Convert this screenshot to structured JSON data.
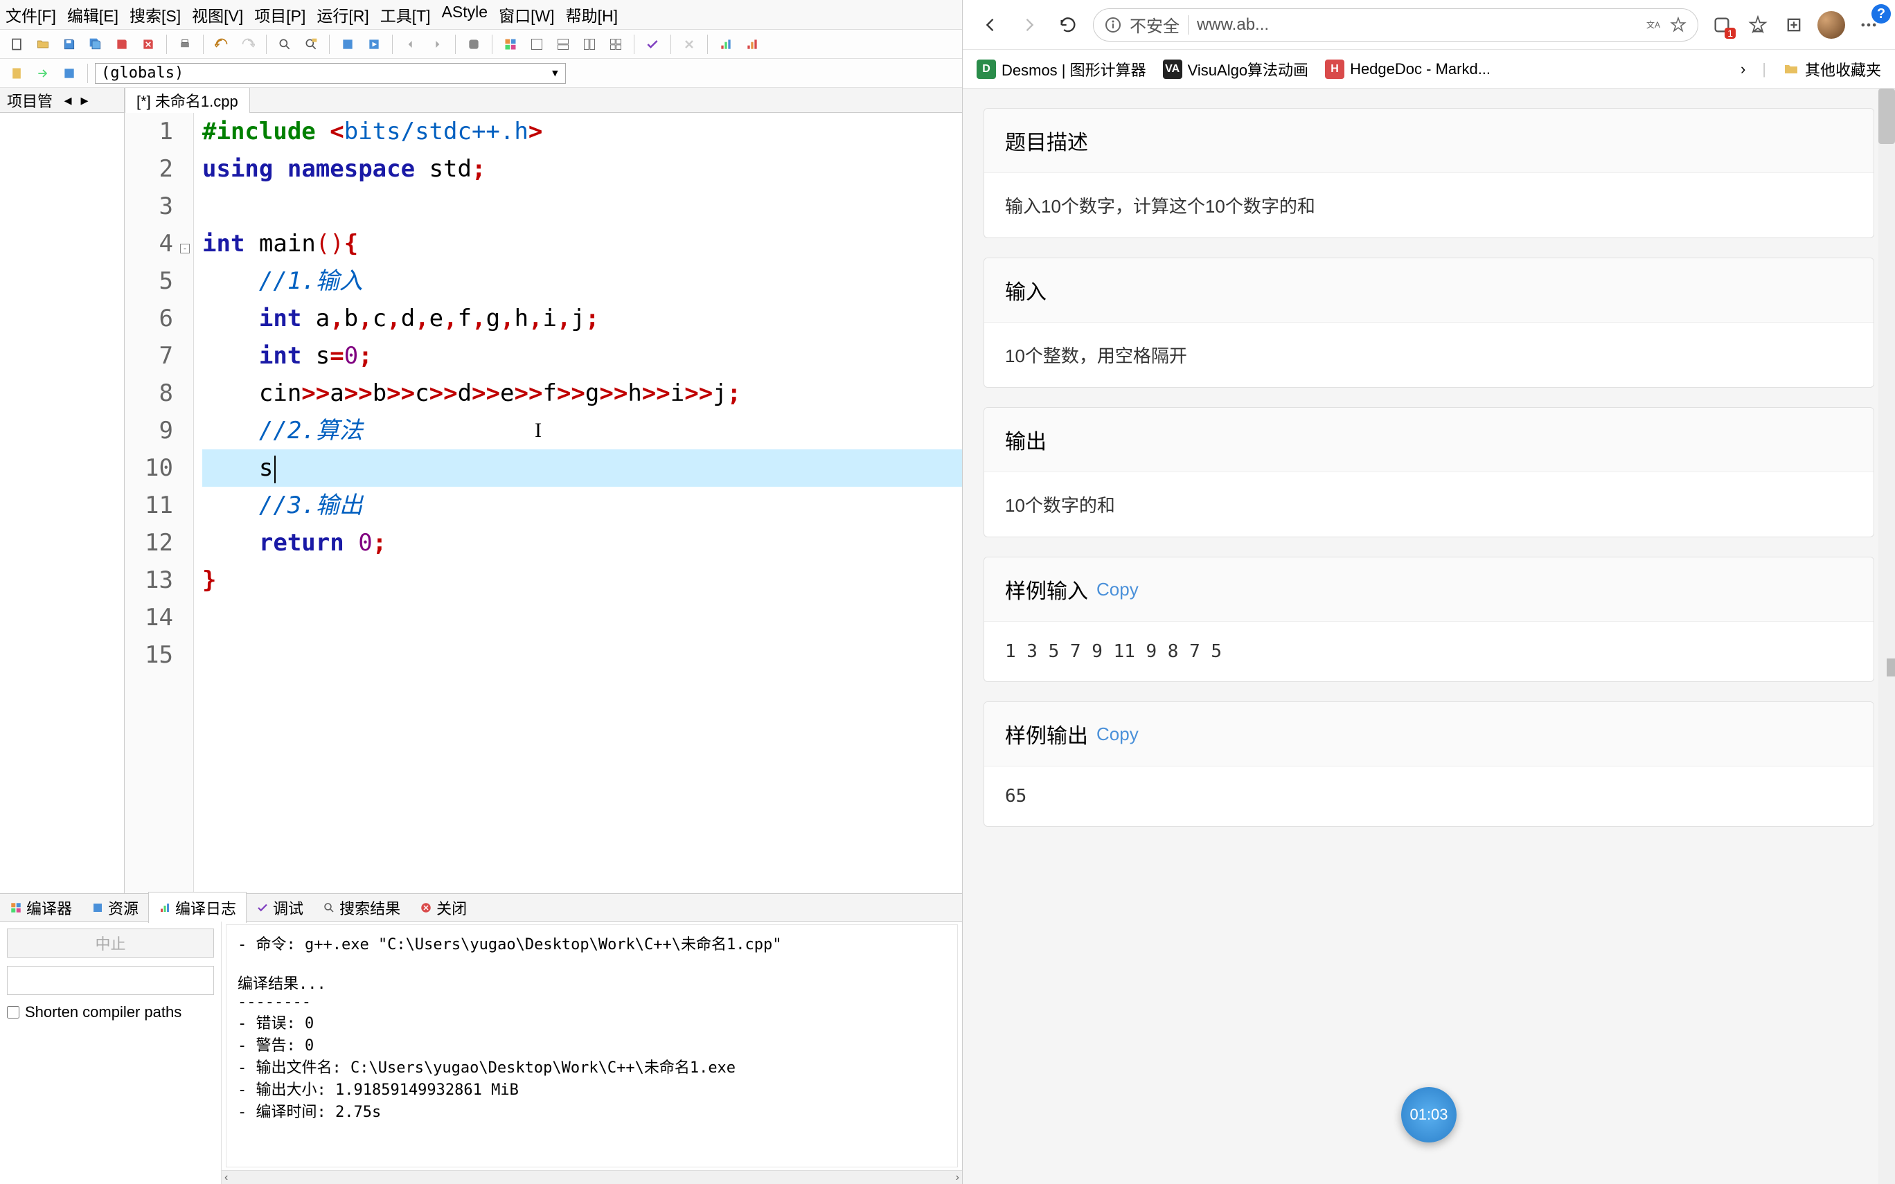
{
  "menubar": {
    "file": "文件[F]",
    "edit": "编辑[E]",
    "search": "搜索[S]",
    "view": "视图[V]",
    "project": "项目[P]",
    "run": "运行[R]",
    "tools": "工具[T]",
    "astyle": "AStyle",
    "window": "窗口[W]",
    "help": "帮助[H]"
  },
  "globals_selector": "(globals)",
  "sidebar": {
    "project_tab": "项目管"
  },
  "file_tab": "[*] 未命名1.cpp",
  "code": {
    "lines": [
      {
        "n": 1,
        "tokens": [
          [
            "preproc",
            "#include "
          ],
          [
            "op",
            "<"
          ],
          [
            "str",
            "bits/stdc++.h"
          ],
          [
            "op",
            ">"
          ]
        ]
      },
      {
        "n": 2,
        "tokens": [
          [
            "kw",
            "using"
          ],
          [
            "",
            " "
          ],
          [
            "kw",
            "namespace"
          ],
          [
            "",
            " "
          ],
          [
            "",
            "std"
          ],
          [
            "op",
            ";"
          ]
        ]
      },
      {
        "n": 3,
        "tokens": []
      },
      {
        "n": 4,
        "fold": true,
        "tokens": [
          [
            "kw",
            "int"
          ],
          [
            "",
            " "
          ],
          [
            "",
            "main"
          ],
          [
            "paren",
            "()"
          ],
          [
            "op",
            "{"
          ]
        ]
      },
      {
        "n": 5,
        "tokens": [
          [
            "",
            "    "
          ],
          [
            "comment",
            "//1.输入"
          ]
        ]
      },
      {
        "n": 6,
        "tokens": [
          [
            "",
            "    "
          ],
          [
            "kw",
            "int"
          ],
          [
            "",
            " a"
          ],
          [
            "op",
            ","
          ],
          [
            "",
            "b"
          ],
          [
            "op",
            ","
          ],
          [
            "",
            "c"
          ],
          [
            "op",
            ","
          ],
          [
            "",
            "d"
          ],
          [
            "op",
            ","
          ],
          [
            "",
            "e"
          ],
          [
            "op",
            ","
          ],
          [
            "",
            "f"
          ],
          [
            "op",
            ","
          ],
          [
            "",
            "g"
          ],
          [
            "op",
            ","
          ],
          [
            "",
            "h"
          ],
          [
            "op",
            ","
          ],
          [
            "",
            "i"
          ],
          [
            "op",
            ","
          ],
          [
            "",
            "j"
          ],
          [
            "op",
            ";"
          ]
        ]
      },
      {
        "n": 7,
        "tokens": [
          [
            "",
            "    "
          ],
          [
            "kw",
            "int"
          ],
          [
            "",
            " s"
          ],
          [
            "op",
            "="
          ],
          [
            "num",
            "0"
          ],
          [
            "op",
            ";"
          ]
        ]
      },
      {
        "n": 8,
        "tokens": [
          [
            "",
            "    cin"
          ],
          [
            "op",
            ">>"
          ],
          [
            "",
            "a"
          ],
          [
            "op",
            ">>"
          ],
          [
            "",
            "b"
          ],
          [
            "op",
            ">>"
          ],
          [
            "",
            "c"
          ],
          [
            "op",
            ">>"
          ],
          [
            "",
            "d"
          ],
          [
            "op",
            ">>"
          ],
          [
            "",
            "e"
          ],
          [
            "op",
            ">>"
          ],
          [
            "",
            "f"
          ],
          [
            "op",
            ">>"
          ],
          [
            "",
            "g"
          ],
          [
            "op",
            ">>"
          ],
          [
            "",
            "h"
          ],
          [
            "op",
            ">>"
          ],
          [
            "",
            "i"
          ],
          [
            "op",
            ">>"
          ],
          [
            "",
            "j"
          ],
          [
            "op",
            ";"
          ]
        ]
      },
      {
        "n": 9,
        "tokens": [
          [
            "",
            "    "
          ],
          [
            "comment",
            "//2.算法"
          ]
        ],
        "caret_i": true
      },
      {
        "n": 10,
        "tokens": [
          [
            "",
            "    s"
          ]
        ],
        "highlight": true,
        "cursor": true
      },
      {
        "n": 11,
        "tokens": [
          [
            "",
            "    "
          ],
          [
            "comment",
            "//3.输出"
          ]
        ]
      },
      {
        "n": 12,
        "tokens": [
          [
            "",
            "    "
          ],
          [
            "kw",
            "return"
          ],
          [
            "",
            " "
          ],
          [
            "num",
            "0"
          ],
          [
            "op",
            ";"
          ]
        ]
      },
      {
        "n": 13,
        "tokens": [
          [
            "op",
            "}"
          ]
        ]
      },
      {
        "n": 14,
        "tokens": []
      },
      {
        "n": 15,
        "tokens": []
      }
    ]
  },
  "bottom_tabs": {
    "compiler": "编译器",
    "resource": "资源",
    "compile_log": "编译日志",
    "debug": "调试",
    "search_results": "搜索结果",
    "close": "关闭"
  },
  "bottom_left": {
    "stop": "中止",
    "shorten": "Shorten compiler paths"
  },
  "compile_log": "- 命令: g++.exe \"C:\\Users\\yugao\\Desktop\\Work\\C++\\未命名1.cpp\"\n\n编译结果...\n--------\n- 错误: 0\n- 警告: 0\n- 输出文件名: C:\\Users\\yugao\\Desktop\\Work\\C++\\未命名1.exe\n- 输出大小: 1.91859149932861 MiB\n- 编译时间: 2.75s",
  "browser": {
    "insecure": "不安全",
    "url": "www.ab...",
    "bookmarks": {
      "desmos": "Desmos | 图形计算器",
      "visualgo": "VisuAlgo算法动画",
      "hedgedoc": "HedgeDoc - Markd...",
      "other": "其他收藏夹"
    },
    "sections": {
      "desc_title": "题目描述",
      "desc_body": "输入10个数字，计算这个10个数字的和",
      "input_title": "输入",
      "input_body": "10个整数，用空格隔开",
      "output_title": "输出",
      "output_body": "10个数字的和",
      "sample_in_title": "样例输入",
      "sample_in_body": "1 3 5 7 9 11 9 8 7 5",
      "sample_out_title": "样例输出",
      "sample_out_body": "65",
      "copy": "Copy"
    },
    "timer": "01:03"
  }
}
